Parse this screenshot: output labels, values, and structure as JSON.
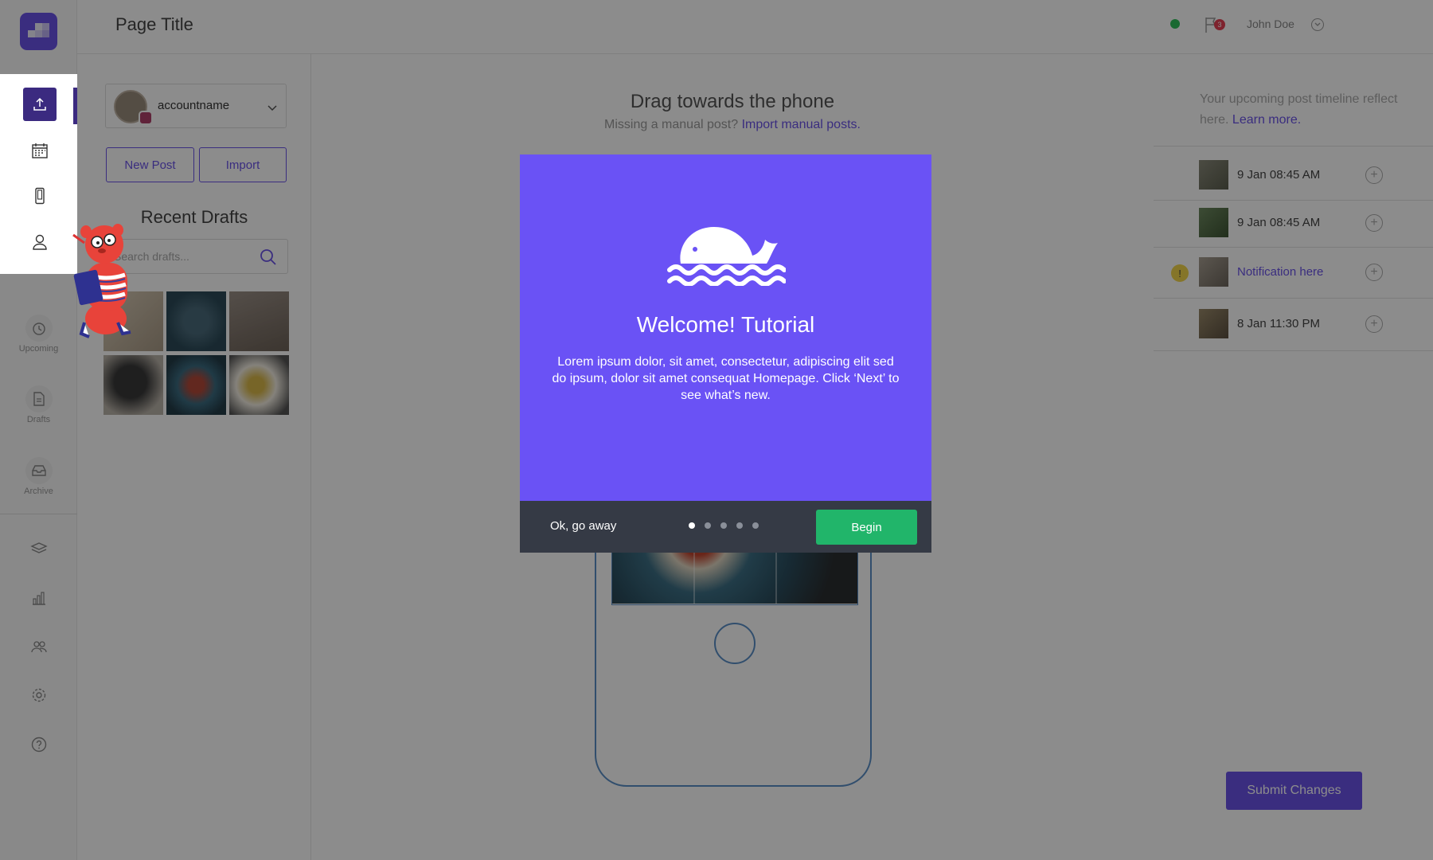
{
  "header": {
    "page_title": "Page Title",
    "notification_count": "3",
    "user_name": "John Doe"
  },
  "sidebar": {
    "items": [
      {
        "label": "Upcoming",
        "icon": "alarm-icon"
      },
      {
        "label": "Drafts",
        "icon": "document-icon"
      },
      {
        "label": "Archive",
        "icon": "inbox-icon"
      }
    ],
    "tools": [
      "layers-icon",
      "analytics-icon",
      "team-icon",
      "settings-icon",
      "help-icon"
    ],
    "spotlight": [
      "upload-icon",
      "calendar-icon",
      "phone-icon",
      "user-icon"
    ]
  },
  "drafts": {
    "account_name": "accountname",
    "new_post_label": "New Post",
    "import_label": "Import",
    "recent_title": "Recent Drafts",
    "search_placeholder": "Search drafts..."
  },
  "center": {
    "drag_title": "Drag towards the phone",
    "missing_text": "Missing a manual post?",
    "import_link": "Import manual posts."
  },
  "timeline": {
    "intro": "Your upcoming post timeline reflect here.",
    "learn_more": "Learn more.",
    "rows": [
      {
        "label": "9 Jan 08:45 AM"
      },
      {
        "label": "9 Jan 08:45 AM"
      },
      {
        "label": "Notification here"
      },
      {
        "label": "8 Jan 11:30 PM"
      }
    ],
    "submit_label": "Submit Changes"
  },
  "modal": {
    "title": "Welcome! Tutorial",
    "body": "Lorem ipsum dolor, sit amet, consectetur, adipiscing elit sed do ipsum, dolor sit amet consequat Homepage. Click ‘Next’ to see what’s new.",
    "skip_label": "Ok, go away",
    "begin_label": "Begin",
    "step_count": 5,
    "current_step": 1
  },
  "colors": {
    "brand": "#6a52e8",
    "modal_bg": "#6a52f5",
    "modal_footer": "#353a45",
    "begin_green": "#21b56a",
    "status_green": "#2fbf5a",
    "badge_red": "#e54155"
  }
}
